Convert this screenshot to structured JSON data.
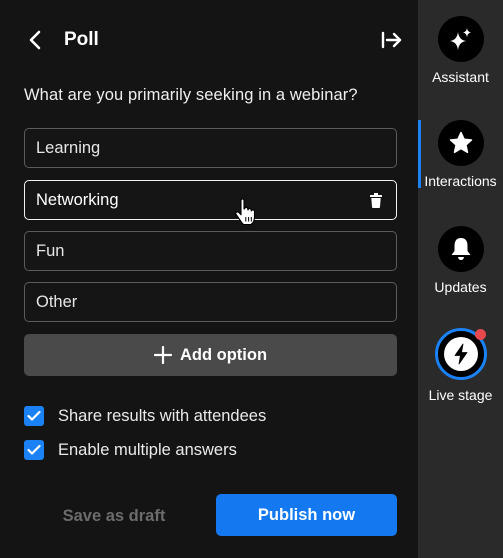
{
  "header": {
    "title": "Poll",
    "back_icon": "chevron-left-icon",
    "collapse_icon": "collapse-right-icon"
  },
  "poll": {
    "question": "What are you primarily seeking in a webinar?",
    "options": [
      {
        "label": "Learning"
      },
      {
        "label": "Networking"
      },
      {
        "label": "Fun"
      },
      {
        "label": "Other"
      }
    ],
    "add_option_label": "Add option"
  },
  "settings": {
    "share_results_label": "Share results with attendees",
    "share_results_checked": true,
    "multiple_answers_label": "Enable multiple answers",
    "multiple_answers_checked": true
  },
  "footer": {
    "draft_label": "Save as draft",
    "publish_label": "Publish now"
  },
  "rail": {
    "items": [
      {
        "label": "Assistant",
        "icon": "sparkle-icon"
      },
      {
        "label": "Interactions",
        "icon": "star-icon",
        "active": true
      },
      {
        "label": "Updates",
        "icon": "bell-icon"
      },
      {
        "label": "Live stage",
        "icon": "lightning-icon",
        "notification": true
      }
    ]
  },
  "colors": {
    "accent": "#1479f0",
    "checkbox": "#1a82f5",
    "notification": "#e5484d",
    "panel_bg": "#141414",
    "rail_bg": "#2a2a2a"
  }
}
